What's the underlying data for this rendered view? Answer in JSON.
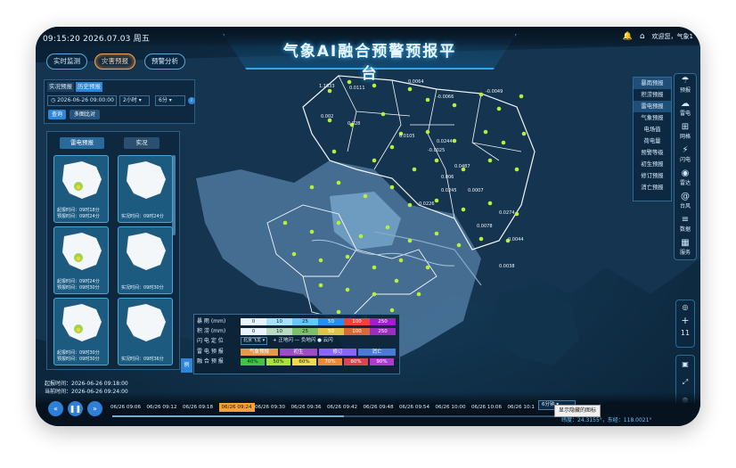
{
  "header": {
    "datetime": "09:15:20 2026.07.03 周五",
    "title": "气象AI融合预警预报平台",
    "user_label": "欢迎您，气象1"
  },
  "top_nav": [
    "实时监测",
    "灾害预报",
    "预警分析"
  ],
  "left_panel": {
    "tabs": [
      "实况预报",
      "历史预报"
    ],
    "datetime_value": "2026-06-26 09:00:00",
    "interval_value": "2小时",
    "step_value": "6分",
    "query_button": "查询",
    "multi_compare_button": "多图比对",
    "product_tabs": [
      "雷电预报",
      "实况"
    ],
    "thumbnails": [
      {
        "line1": "起报时间：09时18分",
        "line2": "预报时间：09时24分"
      },
      {
        "line1": "实况时间：09时24分",
        "line2": ""
      },
      {
        "line1": "起报时间：09时24分",
        "line2": "预报时间：09时30分"
      },
      {
        "line1": "实况时间：09时30分",
        "line2": ""
      },
      {
        "line1": "起报时间：09时30分",
        "line2": "预报时间：09时30分"
      },
      {
        "line1": "实况时间：09时36分",
        "line2": ""
      }
    ]
  },
  "time_info": {
    "start_label": "起报时间：",
    "start_value": "2026-06-26 09:18:00",
    "current_label": "当前时间：",
    "current_value": "2026-06-26 09:24:00"
  },
  "right_menu": [
    "暴雨预报",
    "积涝预报",
    "雷电预报",
    "气象预报",
    "电场值",
    "荷电量",
    "预警等级",
    "初生预报",
    "修订预报",
    "消亡预报"
  ],
  "right_sidebar": [
    {
      "icon": "cloud-rain-icon",
      "glyph": "☂",
      "label": "预报"
    },
    {
      "icon": "cloud-icon",
      "glyph": "☁",
      "label": "雷电"
    },
    {
      "icon": "grid-icon",
      "glyph": "⊞",
      "label": "网格"
    },
    {
      "icon": "lightning-icon",
      "glyph": "⚡",
      "label": "闪电"
    },
    {
      "icon": "radar-icon",
      "glyph": "◉",
      "label": "雷达"
    },
    {
      "icon": "typhoon-icon",
      "glyph": "@",
      "label": "台风"
    },
    {
      "icon": "database-icon",
      "glyph": "≡",
      "label": "数据"
    },
    {
      "icon": "apps-icon",
      "glyph": "▦",
      "label": "服务"
    }
  ],
  "map_controls": {
    "zoom_level": "11"
  },
  "legend": {
    "rain_label": "暴 雨 (mm)",
    "rain_values": [
      "0",
      "10",
      "25",
      "50",
      "100",
      "250"
    ],
    "flood_label": "积 涝 (mm)",
    "flood_values": [
      "0",
      "10",
      "25",
      "50",
      "100",
      "250"
    ],
    "lightning_label": "闪 电 定 位",
    "lightning_select": "北京飞龙",
    "lightning_items": [
      "+ 正地闪",
      "— 负地闪",
      "● 云闪"
    ],
    "thunder_label": "雷 电 预 报",
    "thunder_items": [
      "气象预报",
      "初生",
      "修订",
      "消亡"
    ],
    "fusion_label": "融 合 预 报",
    "fusion_items": [
      "40%",
      "50%",
      "60%",
      "70%",
      "80%",
      "90%"
    ],
    "toggle_label": "例",
    "colors": {
      "rain": [
        "#e8f4ff",
        "#a6e3ff",
        "#64c8ff",
        "#2b8cf0",
        "#f04040",
        "#a020d0"
      ],
      "thunder": [
        "#e89a4a",
        "#a04cc8",
        "#8a66ff",
        "#4a7ad8"
      ],
      "fusion": [
        "#43c243",
        "#a8e23c",
        "#f2d84a",
        "#e8893b",
        "#d84848",
        "#b03ad0"
      ]
    }
  },
  "timeline": {
    "times": [
      "06/26 09:06",
      "06/26 09:12",
      "06/26 09:18",
      "06/26 09:24",
      "06/26 09:30",
      "06/26 09:36",
      "06/26 09:42",
      "06/26 09:48",
      "06/26 09:54",
      "06/26 10:00",
      "06/26 10:06",
      "06/26 10:1"
    ],
    "active_index": 3,
    "step_select": "6分钟",
    "tooltip": "显示隐藏的图标",
    "coords": "纬度：24.3155°，东经：118.0021°"
  },
  "map_values": [
    "1.1633",
    "0.0111",
    "0.0064",
    "-0.0066",
    "-0.0049",
    "0.002",
    "0.028",
    "0.0105",
    "0.0244",
    "0.0487",
    "0.0245",
    "0.0226",
    "0.0078",
    "0.0274",
    "0.0044",
    "0.0038",
    "0.0007",
    "0.006",
    "-0.0025"
  ]
}
